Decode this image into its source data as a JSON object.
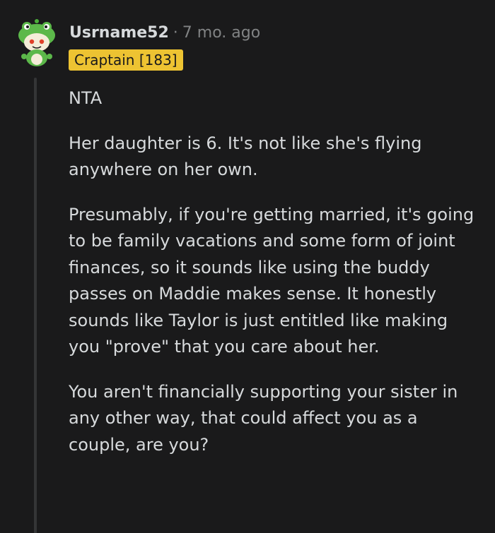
{
  "comment": {
    "username": "Usrname52",
    "separator": "·",
    "time_ago": "7 mo. ago",
    "flair": "Craptain [183]",
    "avatar_icon": "snoo-frog-hat-avatar-icon",
    "paragraphs": [
      "NTA",
      "Her daughter is 6. It's not like she's flying anywhere on her own.",
      "Presumably, if you're getting married, it's going to be family vacations and some form of joint finances, so it sounds like using the buddy passes on Maddie makes sense. It honestly sounds like Taylor is just entitled like making you \"prove\" that you care about her.",
      "You aren't financially supporting your sister in any other way, that could affect you as a couple, are you?"
    ]
  },
  "colors": {
    "background": "#1a1a1b",
    "text": "#d7dadc",
    "meta": "#818384",
    "flair_bg": "#edc332",
    "thread_line": "#343536"
  }
}
